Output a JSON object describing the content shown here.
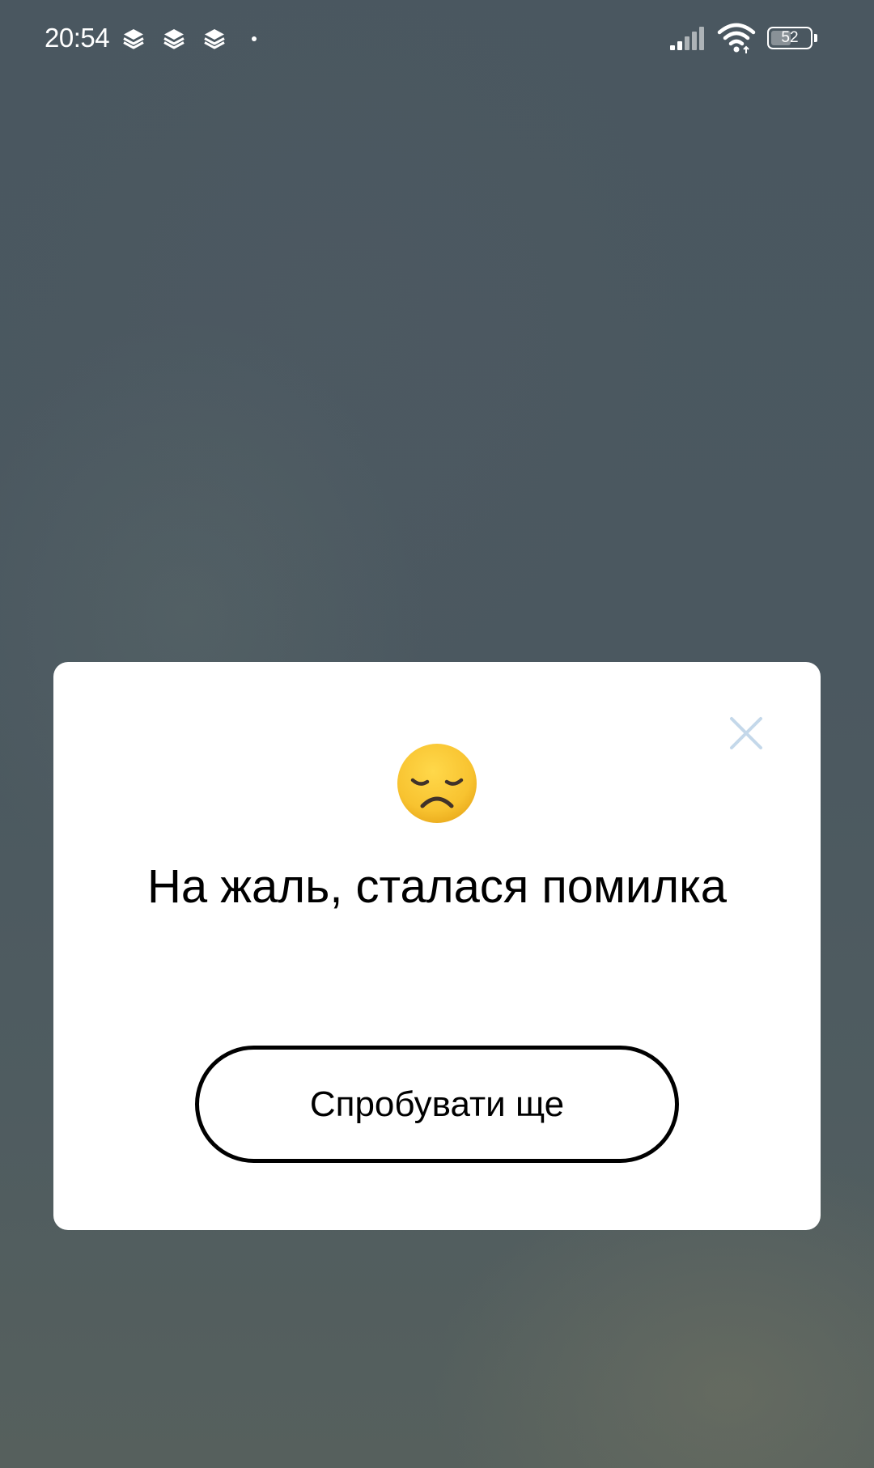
{
  "status_bar": {
    "time": "20:54",
    "notification_icons": [
      "layers-icon",
      "layers-icon",
      "layers-icon",
      "dot-icon"
    ],
    "signal_icon": "cellular-signal-icon",
    "wifi_icon": "wifi-icon",
    "battery_level": "52",
    "battery_fraction": 0.52
  },
  "dialog": {
    "emoji": "disappointed-face-emoji",
    "title": "На жаль, сталася помилка",
    "retry_label": "Спробувати ще",
    "close_icon": "close-icon"
  },
  "colors": {
    "backdrop": "#4b5961",
    "dialog_background": "#ffffff",
    "close_icon": "#c4d8ea",
    "text": "#000000",
    "emoji_face": "#f8c330"
  }
}
